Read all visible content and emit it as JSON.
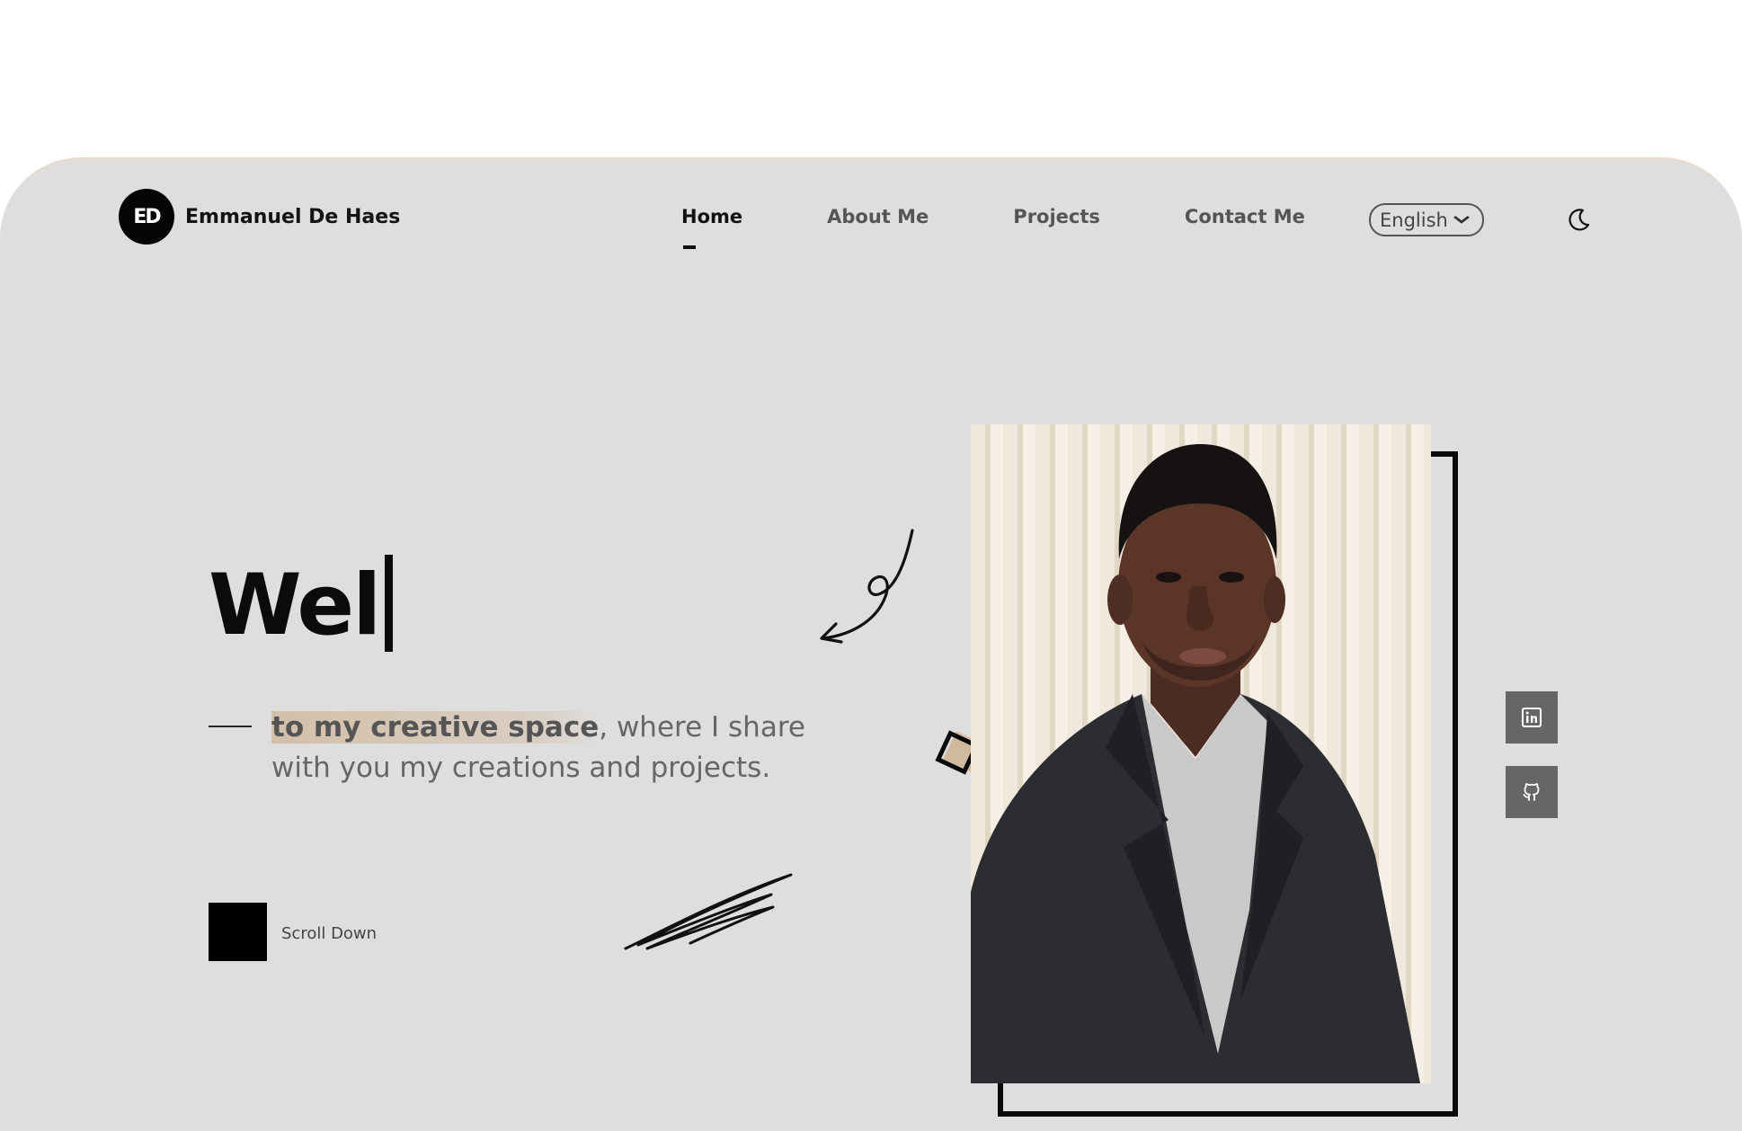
{
  "brand": {
    "logo_text": "ED",
    "name": "Emmanuel De Haes"
  },
  "nav": {
    "items": [
      {
        "label": "Home",
        "active": true
      },
      {
        "label": "About Me",
        "active": false
      },
      {
        "label": "Projects",
        "active": false
      },
      {
        "label": "Contact Me",
        "active": false
      }
    ],
    "language": "English",
    "theme_icon": "moon-icon"
  },
  "hero": {
    "title_typed": "Wel",
    "tagline_highlight": "to my creative space",
    "tagline_rest": ", where I share with you my creations and projects.",
    "scroll_label": "Scroll Down"
  },
  "social": [
    {
      "name": "LinkedIn",
      "icon": "linkedin-icon"
    },
    {
      "name": "GitHub",
      "icon": "github-icon"
    }
  ],
  "colors": {
    "background": "#dedede",
    "accent": "#cdaf8c",
    "dark": "#0b0b0b",
    "social_button": "#666666"
  }
}
